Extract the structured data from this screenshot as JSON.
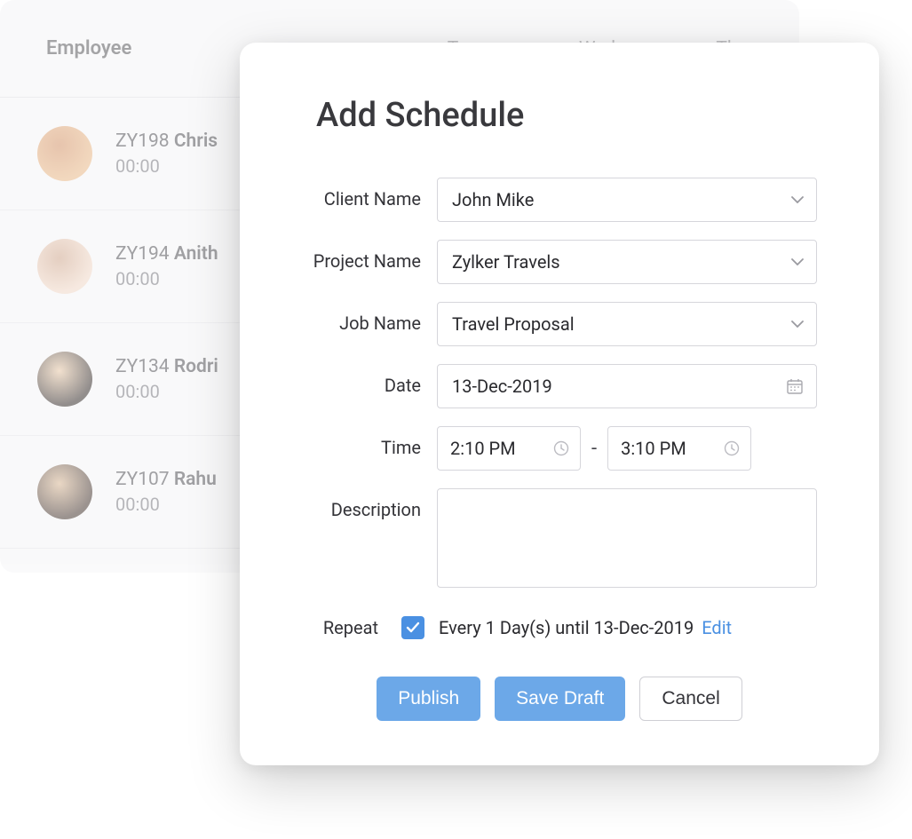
{
  "background": {
    "header_employee": "Employee",
    "header_days": [
      "Tue",
      "Wed",
      "Thu"
    ],
    "employees": [
      {
        "id": "ZY198",
        "name": "Chris",
        "time": "00:00",
        "avatar_colors": [
          "#e8b98a",
          "#d4956b"
        ]
      },
      {
        "id": "ZY194",
        "name": "Anith",
        "time": "00:00",
        "avatar_colors": [
          "#f0d8c8",
          "#cfa88f"
        ]
      },
      {
        "id": "ZY134",
        "name": "Rodri",
        "time": "00:00",
        "avatar_colors": [
          "#3a3230",
          "#e8c9a8"
        ]
      },
      {
        "id": "ZY107",
        "name": "Rahu",
        "time": "00:00",
        "avatar_colors": [
          "#4a3b35",
          "#d9b896"
        ]
      }
    ]
  },
  "modal": {
    "title": "Add Schedule",
    "labels": {
      "client_name": "Client Name",
      "project_name": "Project Name",
      "job_name": "Job Name",
      "date": "Date",
      "time": "Time",
      "description": "Description",
      "repeat": "Repeat"
    },
    "values": {
      "client_name": "John Mike",
      "project_name": "Zylker Travels",
      "job_name": "Travel Proposal",
      "date": "13-Dec-2019",
      "time_start": "2:10 PM",
      "time_end": "3:10 PM",
      "time_separator": "-",
      "description": "",
      "repeat_checked": true,
      "repeat_text": "Every 1 Day(s) until 13-Dec-2019",
      "edit_text": "Edit"
    },
    "buttons": {
      "publish": "Publish",
      "save_draft": "Save Draft",
      "cancel": "Cancel"
    }
  }
}
